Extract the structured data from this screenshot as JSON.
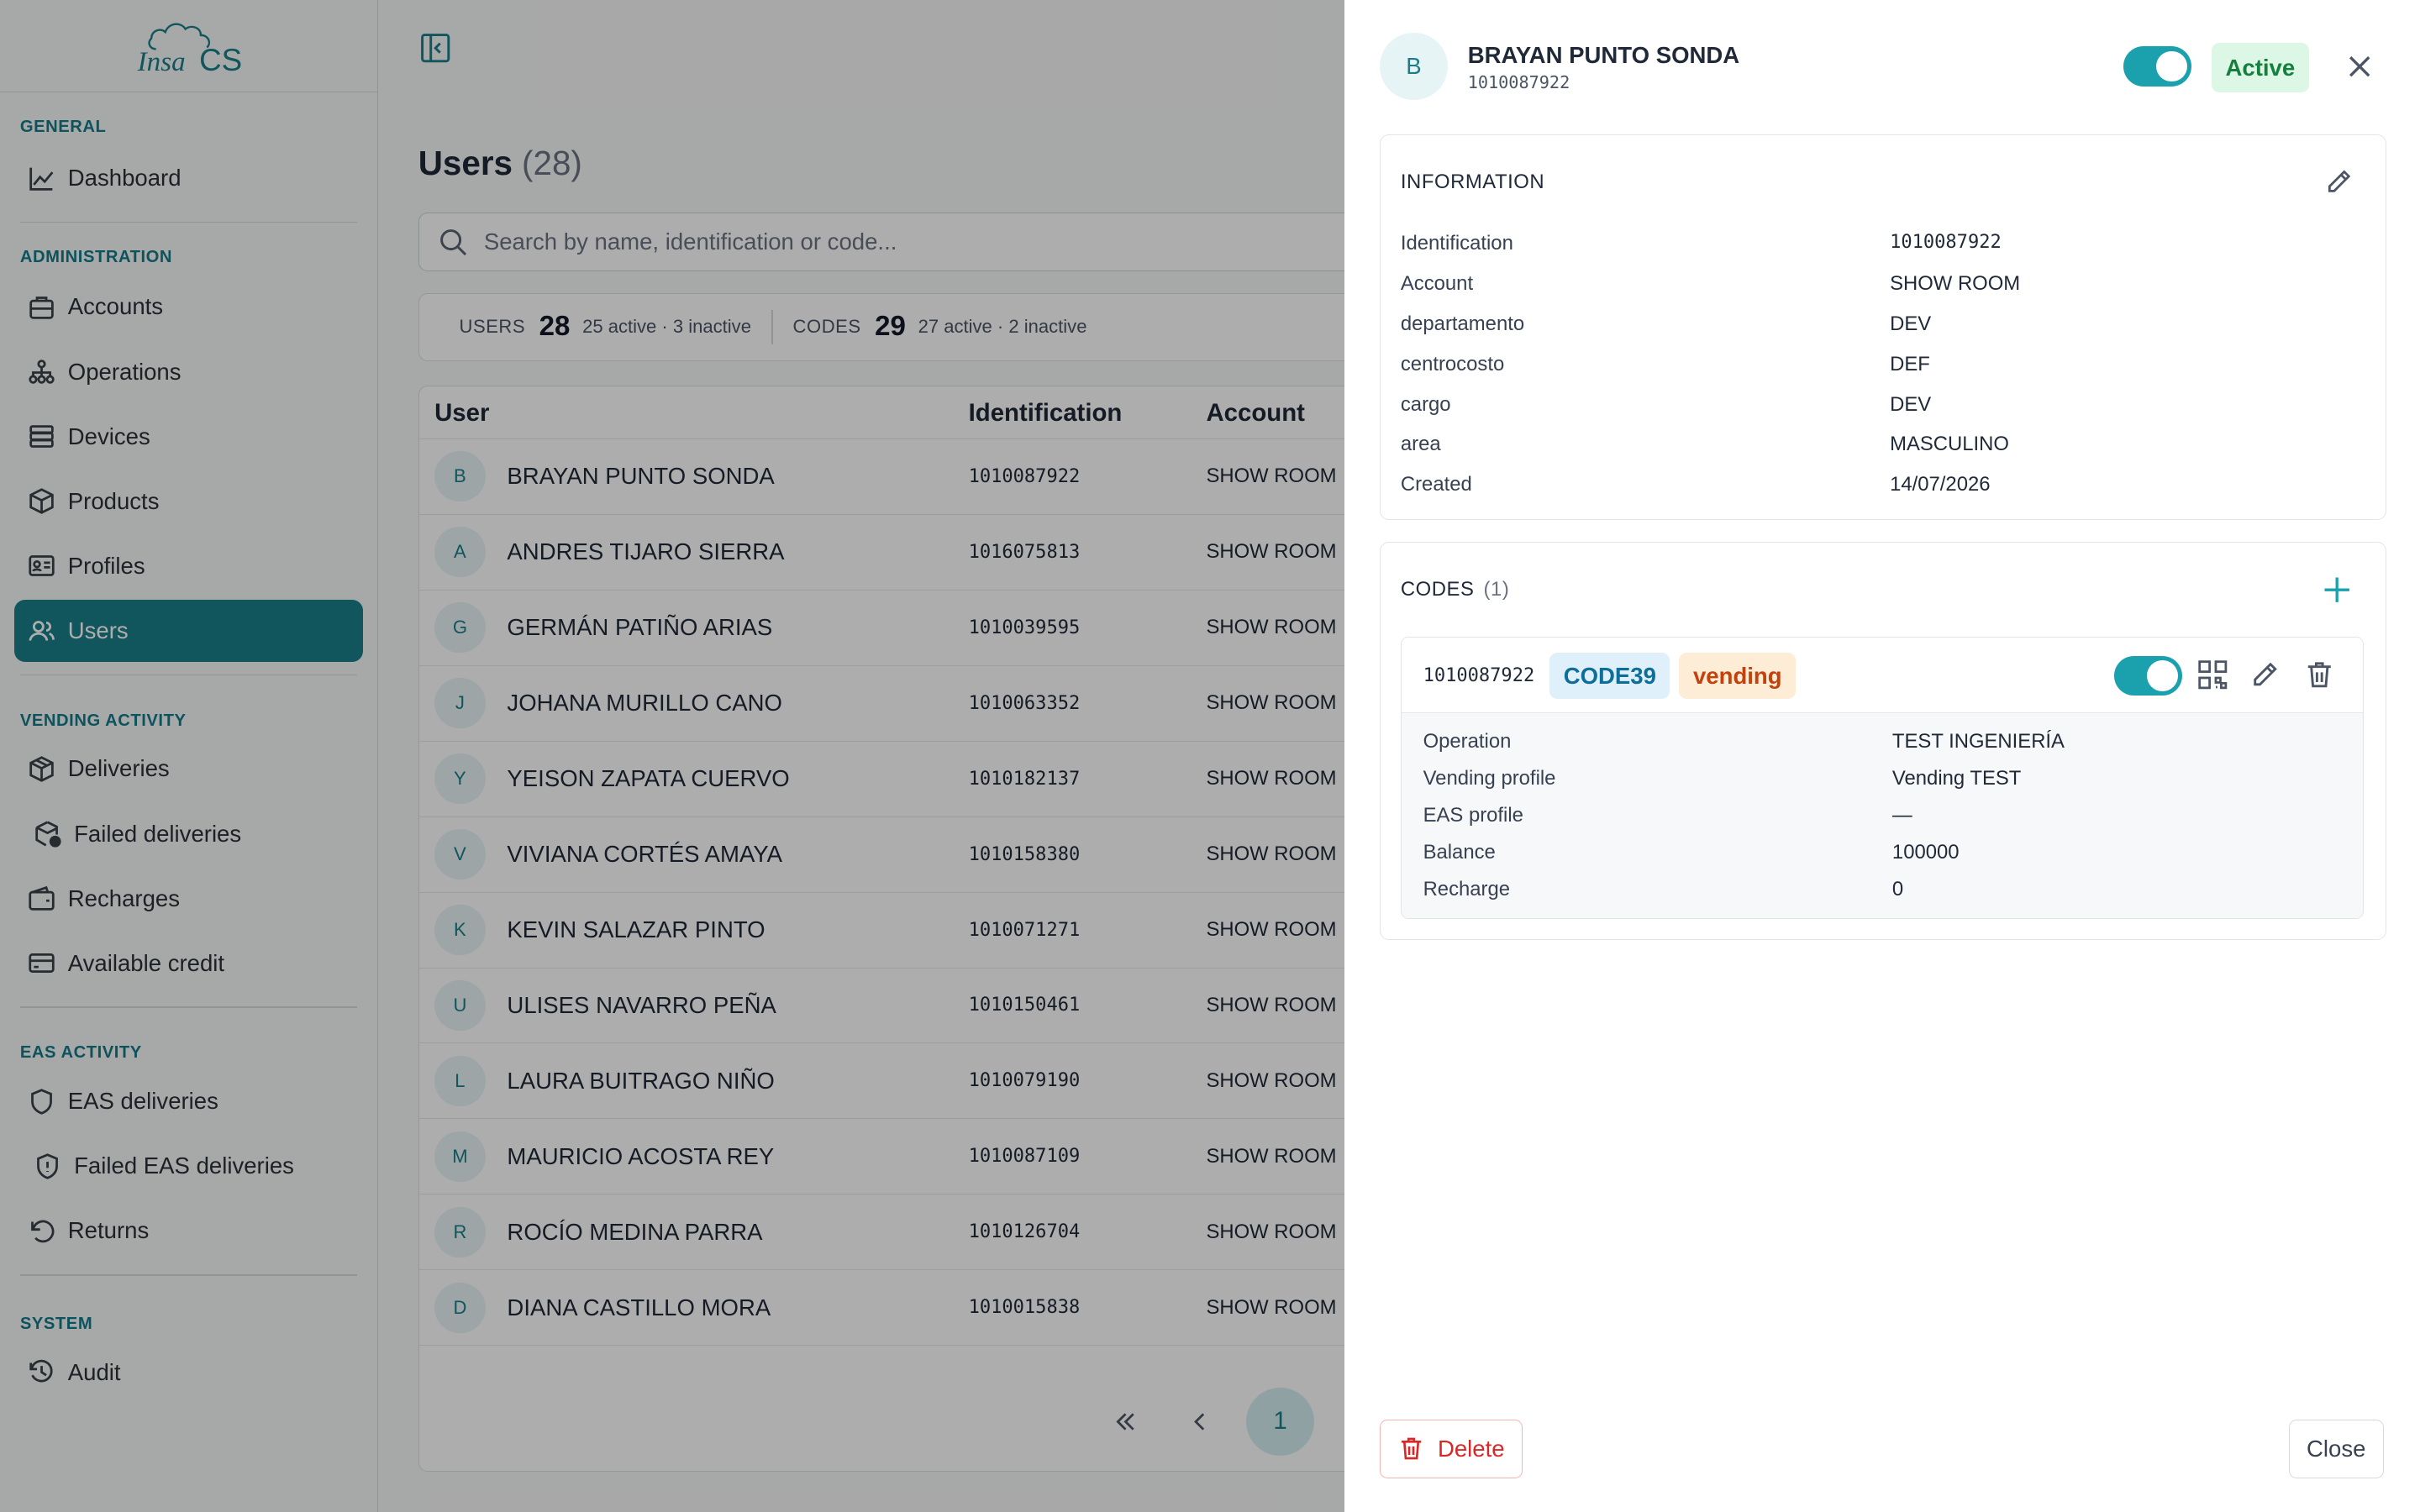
{
  "brand": {
    "logo_text": "Insa CS",
    "accent": "#1a7e8a"
  },
  "sidebar": {
    "sections": [
      {
        "title": "GENERAL",
        "items": [
          {
            "label": "Dashboard",
            "icon": "chart-line-icon"
          }
        ]
      },
      {
        "title": "ADMINISTRATION",
        "items": [
          {
            "label": "Accounts",
            "icon": "briefcase-icon"
          },
          {
            "label": "Operations",
            "icon": "sitemap-icon"
          },
          {
            "label": "Devices",
            "icon": "server-icon"
          },
          {
            "label": "Products",
            "icon": "box-icon"
          },
          {
            "label": "Profiles",
            "icon": "id-card-icon"
          },
          {
            "label": "Users",
            "icon": "users-icon",
            "active": true
          }
        ]
      },
      {
        "title": "VENDING ACTIVITY",
        "items": [
          {
            "label": "Deliveries",
            "icon": "package-icon"
          },
          {
            "label": "Failed deliveries",
            "icon": "package-alert-icon"
          },
          {
            "label": "Recharges",
            "icon": "wallet-icon"
          },
          {
            "label": "Available credit",
            "icon": "credit-card-icon"
          }
        ]
      },
      {
        "title": "EAS ACTIVITY",
        "items": [
          {
            "label": "EAS deliveries",
            "icon": "shield-icon"
          },
          {
            "label": "Failed EAS deliveries",
            "icon": "shield-alert-icon"
          },
          {
            "label": "Returns",
            "icon": "undo-icon"
          }
        ]
      },
      {
        "title": "SYSTEM",
        "items": [
          {
            "label": "Audit",
            "icon": "history-icon"
          }
        ]
      }
    ]
  },
  "main": {
    "title": "Users",
    "title_count": "(28)",
    "search_placeholder": "Search by name, identification or code...",
    "stats": {
      "users_label": "USERS",
      "users_count": "28",
      "users_sub": "25 active · 3 inactive",
      "codes_label": "CODES",
      "codes_count": "29",
      "codes_sub": "27 active · 2 inactive"
    },
    "table": {
      "columns": [
        "User",
        "Identification",
        "Account"
      ],
      "rows": [
        {
          "initial": "B",
          "name": "BRAYAN PUNTO SONDA",
          "id": "1010087922",
          "account": "SHOW ROOM"
        },
        {
          "initial": "A",
          "name": "ANDRES TIJARO SIERRA",
          "id": "1016075813",
          "account": "SHOW ROOM"
        },
        {
          "initial": "G",
          "name": "GERMÁN PATIÑO ARIAS",
          "id": "1010039595",
          "account": "SHOW ROOM"
        },
        {
          "initial": "J",
          "name": "JOHANA MURILLO CANO",
          "id": "1010063352",
          "account": "SHOW ROOM"
        },
        {
          "initial": "Y",
          "name": "YEISON ZAPATA CUERVO",
          "id": "1010182137",
          "account": "SHOW ROOM"
        },
        {
          "initial": "V",
          "name": "VIVIANA CORTÉS AMAYA",
          "id": "1010158380",
          "account": "SHOW ROOM"
        },
        {
          "initial": "K",
          "name": "KEVIN SALAZAR PINTO",
          "id": "1010071271",
          "account": "SHOW ROOM"
        },
        {
          "initial": "U",
          "name": "ULISES NAVARRO PEÑA",
          "id": "1010150461",
          "account": "SHOW ROOM"
        },
        {
          "initial": "L",
          "name": "LAURA BUITRAGO NIÑO",
          "id": "1010079190",
          "account": "SHOW ROOM"
        },
        {
          "initial": "M",
          "name": "MAURICIO ACOSTA REY",
          "id": "1010087109",
          "account": "SHOW ROOM"
        },
        {
          "initial": "R",
          "name": "ROCÍO MEDINA PARRA",
          "id": "1010126704",
          "account": "SHOW ROOM"
        },
        {
          "initial": "D",
          "name": "DIANA CASTILLO MORA",
          "id": "1010015838",
          "account": "SHOW ROOM"
        }
      ]
    },
    "pagination": {
      "first": "«",
      "prev": "‹",
      "current": "1"
    }
  },
  "drawer": {
    "initial": "B",
    "name": "BRAYAN PUNTO SONDA",
    "id": "1010087922",
    "status": "Active",
    "information_title": "INFORMATION",
    "info": [
      {
        "label": "Identification",
        "value": "1010087922",
        "mono": true
      },
      {
        "label": "Account",
        "value": "SHOW ROOM"
      },
      {
        "label": "departamento",
        "value": "DEV"
      },
      {
        "label": "centrocosto",
        "value": "DEF"
      },
      {
        "label": "cargo",
        "value": "DEV"
      },
      {
        "label": "area",
        "value": "MASCULINO"
      },
      {
        "label": "Created",
        "value": "14/07/2026"
      }
    ],
    "codes_title": "CODES",
    "codes_count": "(1)",
    "code": {
      "value": "1010087922",
      "type": "CODE39",
      "kind": "vending",
      "details": [
        {
          "label": "Operation",
          "value": "TEST INGENIERÍA"
        },
        {
          "label": "Vending profile",
          "value": "Vending TEST"
        },
        {
          "label": "EAS profile",
          "value": "—"
        },
        {
          "label": "Balance",
          "value": "100000"
        },
        {
          "label": "Recharge",
          "value": "0"
        }
      ]
    },
    "delete_label": "Delete",
    "close_label": "Close"
  }
}
